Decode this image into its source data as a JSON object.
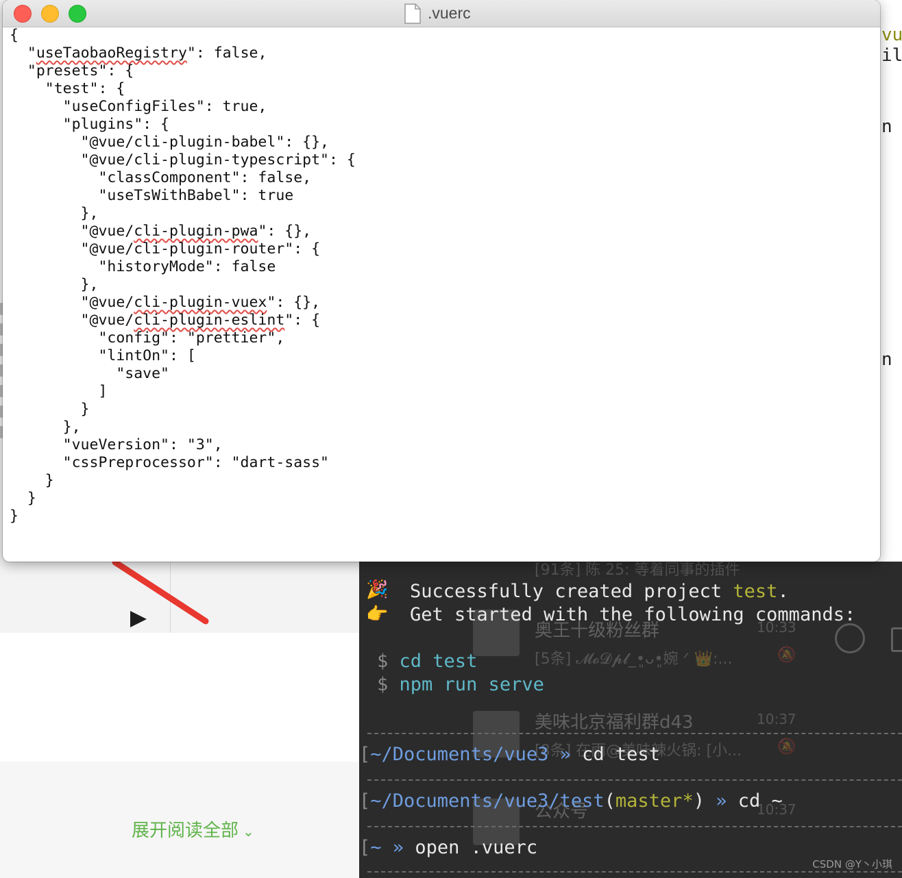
{
  "window": {
    "title": ".vuerc",
    "close": "close",
    "minimize": "minimize",
    "maximize": "maximize"
  },
  "document": {
    "lines": [
      "{",
      "  \"useTaobaoRegistry\": false,",
      "  \"presets\": {",
      "    \"test\": {",
      "      \"useConfigFiles\": true,",
      "      \"plugins\": {",
      "        \"@vue/cli-plugin-babel\": {},",
      "        \"@vue/cli-plugin-typescript\": {",
      "          \"classComponent\": false,",
      "          \"useTsWithBabel\": true",
      "        },",
      "        \"@vue/cli-plugin-pwa\": {},",
      "        \"@vue/cli-plugin-router\": {",
      "          \"historyMode\": false",
      "        },",
      "        \"@vue/cli-plugin-vuex\": {},",
      "        \"@vue/cli-plugin-eslint\": {",
      "          \"config\": \"prettier\",",
      "          \"lintOn\": [",
      "            \"save\"",
      "          ]",
      "        }",
      "      },",
      "      \"vueVersion\": \"3\",",
      "      \"cssPreprocessor\": \"dart-sass\"",
      "    }",
      "  }",
      "}"
    ]
  },
  "terminal": {
    "success_prefix": "Successfully created project ",
    "project_name": "test",
    "success_suffix": ".",
    "get_started": "Get started with the following commands:",
    "dollar": "$",
    "cmd_cd_test": "cd test",
    "cmd_npm_serve": "npm run serve",
    "prompt1_path": "~/Documents/vue3",
    "arrow": "»",
    "prompt1_cmd": "cd test",
    "prompt2_path": "~/Documents/vue3/test",
    "prompt2_branch_open": "(",
    "prompt2_branch": "master",
    "prompt2_dirty": "*",
    "prompt2_branch_close": ")",
    "prompt2_cmd": "cd ~",
    "prompt3_path": "~",
    "prompt3_cmd": "open .vuerc",
    "bracket": "["
  },
  "chat_ghost": {
    "item1_sub": "[91条] 陈 25: 等着同事的插件",
    "item2_title": "奥王十级粉丝群",
    "item2_time": "10:33",
    "item2_sub": "[5条] 𝓜𝓸𝓓𝓹𝓵_•͈ᴗ•͈婉 ᐟ 👑:...",
    "item3_title": "美味北京福利群d43",
    "item3_time": "10:37",
    "item3_sub": "[8条] 在雨@美味辣火锅: [小...",
    "item4_title": "公众号",
    "item4_time": "10:37"
  },
  "background": {
    "expand_link": "展开阅读全部",
    "edge_vu": "vu",
    "edge_il": "il",
    "edge_n1": "n",
    "edge_n2": "n"
  },
  "watermark": "CSDN @Y丶小琪",
  "colors": {
    "terminal_bg": "#2b2b2b",
    "cyan": "#5fb8c9",
    "yellow": "#b4b43a",
    "link_green": "#5fb34a"
  }
}
